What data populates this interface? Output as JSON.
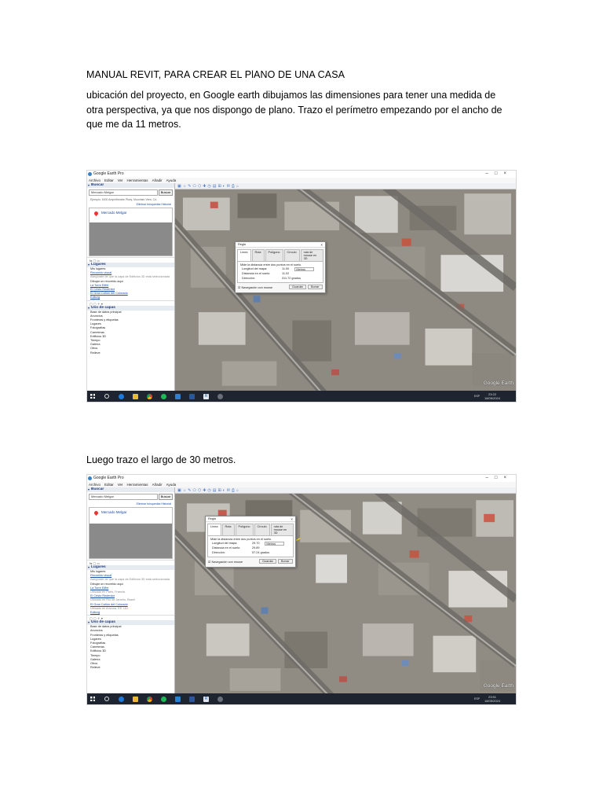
{
  "document": {
    "title": "MANUAL REVIT, PARA CREAR EL PlANO DE UNA CASA",
    "paragraph_1": "ubicación del proyecto, en Google earth dibujamos las dimensiones para tener una medida de otra perspectiva, ya que nos dispongo de plano. Trazo el perímetro empezando por el ancho de que me da 11 metros.",
    "paragraph_2": "Luego trazo el largo de 30 metros."
  },
  "screenshot_1": {
    "window_title": "Google Earth Pro",
    "menu": [
      "Archivo",
      "Editar",
      "Ver",
      "Herramientas",
      "Añadir",
      "Ayuda"
    ],
    "search_header": "Buscar",
    "search_value": "Mercado Melgar",
    "search_button": "Buscar",
    "search_hint": "Ejemplo: 1600 Amphitheatre Pkwy, Mountain View, CA",
    "search_links": "Eliminar búsquedas  Historial",
    "result_name": "Mercado Melgar",
    "places_header": "Lugares",
    "places_items": [
      "Mis lugares",
      "Recorrido visual",
      "Asegúrate de que la capa de Edificios 3D está seleccionada",
      "Dibujar un recorrido aquí",
      "La Torre Eiffel",
      "El Cristo Redentor",
      "El Gran Cañón del Colorado",
      "Editorg"
    ],
    "layers_header": "Uso de capas",
    "layers_items": [
      "Base de datos principal",
      "Anuncios",
      "Fronteras y etiquetas",
      "Lugares",
      "Fotografías",
      "Carreteras",
      "Edificios 3D",
      "Tiempo",
      "Galería",
      "Otros",
      "Relieve"
    ],
    "ruler": {
      "title": "Regla",
      "tabs": [
        "Línea",
        "Ruta",
        "Polígono",
        "Círculo",
        "ruta de mouse en 3D"
      ],
      "instruction": "Mide la distancia entre dos puntos en el suelo.",
      "length_label": "Longitud del mapa:",
      "length_value": "11.00",
      "unit": "Metros",
      "ground_label": "Distancia en el suelo:",
      "ground_value": "11.02",
      "heading_label": "Dirección:",
      "heading_value": "311.72 grados",
      "nav_label": "Navegación con mouse",
      "save_button": "Guardar",
      "clear_button": "Borrar"
    },
    "clock_time": "23:22",
    "clock_date": "18/05/2024",
    "lang": "ESP",
    "map_logo": "Google Earth"
  },
  "screenshot_2": {
    "window_title": "Google Earth Pro",
    "menu": [
      "Archivo",
      "Editar",
      "Ver",
      "Herramientas",
      "Añadir",
      "Ayuda"
    ],
    "search_header": "Buscar",
    "search_value": "Mercado Melgar",
    "search_button": "Buscar",
    "search_links": "Eliminar búsquedas  Historial",
    "result_name": "Mercado Melgar",
    "places_header": "Lugares",
    "places_items": [
      "Mis lugares",
      "Recorrido visual",
      "Asegúrate de que la capa de Edificios 3D está seleccionada",
      "Dibujar un recorrido aquí",
      "La Torre Eiffel",
      "Ubicado en París, Francia",
      "El Cristo Redentor",
      "Ubicado en Río de Janeiro, Brasil",
      "El Gran Cañón del Colorado",
      "Ubicado en Arizona, EE. UU.",
      "Editorg"
    ],
    "layers_header": "Uso de capas",
    "layers_items": [
      "Base de datos principal",
      "Anuncios",
      "Fronteras y etiquetas",
      "Lugares",
      "Fotografías",
      "Carreteras",
      "Edificios 3D",
      "Tiempo",
      "Galería",
      "Otros",
      "Relieve"
    ],
    "ruler": {
      "title": "Regla",
      "tabs": [
        "Línea",
        "Ruta",
        "Polígono",
        "Círculo",
        "ruta de mouse en 3D"
      ],
      "instruction": "Mide la distancia entre dos puntos en el suelo.",
      "length_label": "Longitud del mapa:",
      "length_value": "29.70",
      "unit": "Metros",
      "ground_label": "Distancia en el suelo:",
      "ground_value": "29.89",
      "heading_label": "Dirección:",
      "heading_value": "57.24 grados",
      "nav_label": "Navegación con mouse",
      "save_button": "Guardar",
      "clear_button": "Borrar"
    },
    "clock_time": "23:51",
    "clock_date": "18/05/2024",
    "lang": "ESP",
    "map_logo": "Google Earth"
  },
  "colors": {
    "taskbar": "#1e2530",
    "map_base": "#8d8a83",
    "link": "#1a4da8",
    "pin": "#e53935"
  },
  "icons": [
    "windows-start-icon",
    "search-icon",
    "edge-icon",
    "file-explorer-icon",
    "chrome-icon",
    "spotify-icon",
    "mail-icon",
    "word-icon",
    "revit-icon",
    "google-earth-icon",
    "placemark-pin-icon"
  ]
}
